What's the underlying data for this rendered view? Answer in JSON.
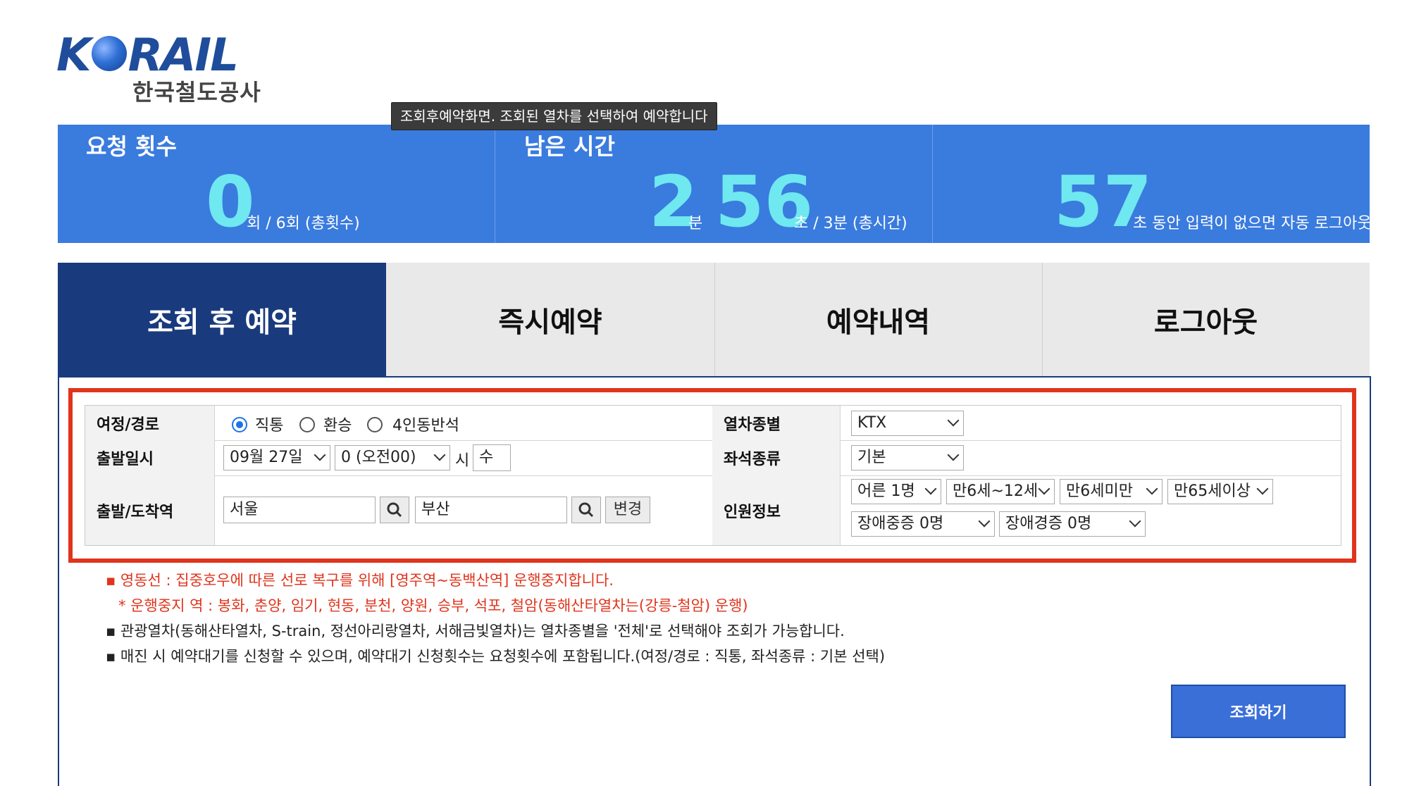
{
  "logo": {
    "wordmark_pre": "K",
    "wordmark_post": "RAIL",
    "subtitle": "한국철도공사"
  },
  "tooltip": "조회후예약화면. 조회된 열차를 선택하여 예약합니다",
  "stats": {
    "requests": {
      "label": "요청 횟수",
      "value": "0",
      "suffix": "회 / 6회 (총횟수)"
    },
    "remaining": {
      "label": "남은 시간",
      "minutes": "2",
      "min_unit": "분",
      "seconds": "56",
      "suffix": "초 / 3분 (총시간)"
    },
    "logout": {
      "value": "57",
      "suffix": "초 동안 입력이 없으면 자동 로그아웃"
    }
  },
  "tabs": [
    {
      "label": "조회 후 예약",
      "active": true
    },
    {
      "label": "즉시예약",
      "active": false
    },
    {
      "label": "예약내역",
      "active": false
    },
    {
      "label": "로그아웃",
      "active": false
    }
  ],
  "form": {
    "route": {
      "label": "여정/경로",
      "options": [
        "직통",
        "환승",
        "4인동반석"
      ],
      "selected": "직통"
    },
    "train_type": {
      "label": "열차종별",
      "value": "KTX"
    },
    "departure": {
      "label": "출발일시",
      "date": "09월 27일",
      "hour": "0 (오전00)",
      "hour_suffix": "시",
      "weekday": "수"
    },
    "seat_type": {
      "label": "좌석종류",
      "value": "기본"
    },
    "stations": {
      "label": "출발/도착역",
      "from": "서울",
      "to": "부산",
      "change_label": "변경"
    },
    "passengers": {
      "label": "인원정보",
      "adult": "어른 1명",
      "child": "만6세~12세",
      "infant": "만6세미만",
      "senior": "만65세이상",
      "disabled_severe": "장애중증 0명",
      "disabled_mild": "장애경증 0명"
    }
  },
  "notices": [
    "▪ 영동선 : 집중호우에 따른 선로 복구를 위해 [영주역~동백산역] 운행중지합니다.",
    "* 운행중지 역 : 봉화, 춘양, 임기, 현동, 분천, 양원, 승부, 석포, 철암(동해산타열차는(강릉-철암) 운행)",
    "▪ 관광열차(동해산타열차, S-train, 정선아리랑열차, 서해금빛열차)는 열차종별을 '전체'로 선택해야 조회가 가능합니다.",
    "▪ 매진 시 예약대기를 신청할 수 있으며, 예약대기 신청횟수는 요청횟수에 포함됩니다.(여정/경로 : 직통, 좌석종류 : 기본 선택)"
  ],
  "search_button": "조회하기",
  "colors": {
    "stats_bg": "#3a7bde",
    "big_number": "#6fe8f0",
    "active_tab": "#1a3a7e",
    "highlight_box": "#e0341c",
    "notice_red": "#e0341c",
    "search_button": "#3a6fd8"
  }
}
